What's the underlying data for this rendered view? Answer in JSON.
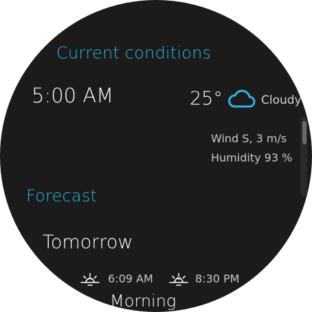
{
  "current": {
    "title": "Current conditions",
    "time": "5:00 AM",
    "temperature": "25°",
    "condition": "Cloudy",
    "condition_icon": "cloud-icon",
    "wind": "Wind S, 3 m/s",
    "humidity": "Humidity 93 %"
  },
  "forecast": {
    "title": "Forecast",
    "day": "Tomorrow",
    "sunrise": {
      "icon": "sunrise-icon",
      "time": "6:09 AM"
    },
    "sunset": {
      "icon": "sunset-icon",
      "time": "8:30 PM"
    },
    "period": "Morning"
  },
  "colors": {
    "accent": "#2ab7e6",
    "background": "#1b1b1b",
    "text": "#ffffff",
    "secondary_text": "#c8c8c8"
  }
}
